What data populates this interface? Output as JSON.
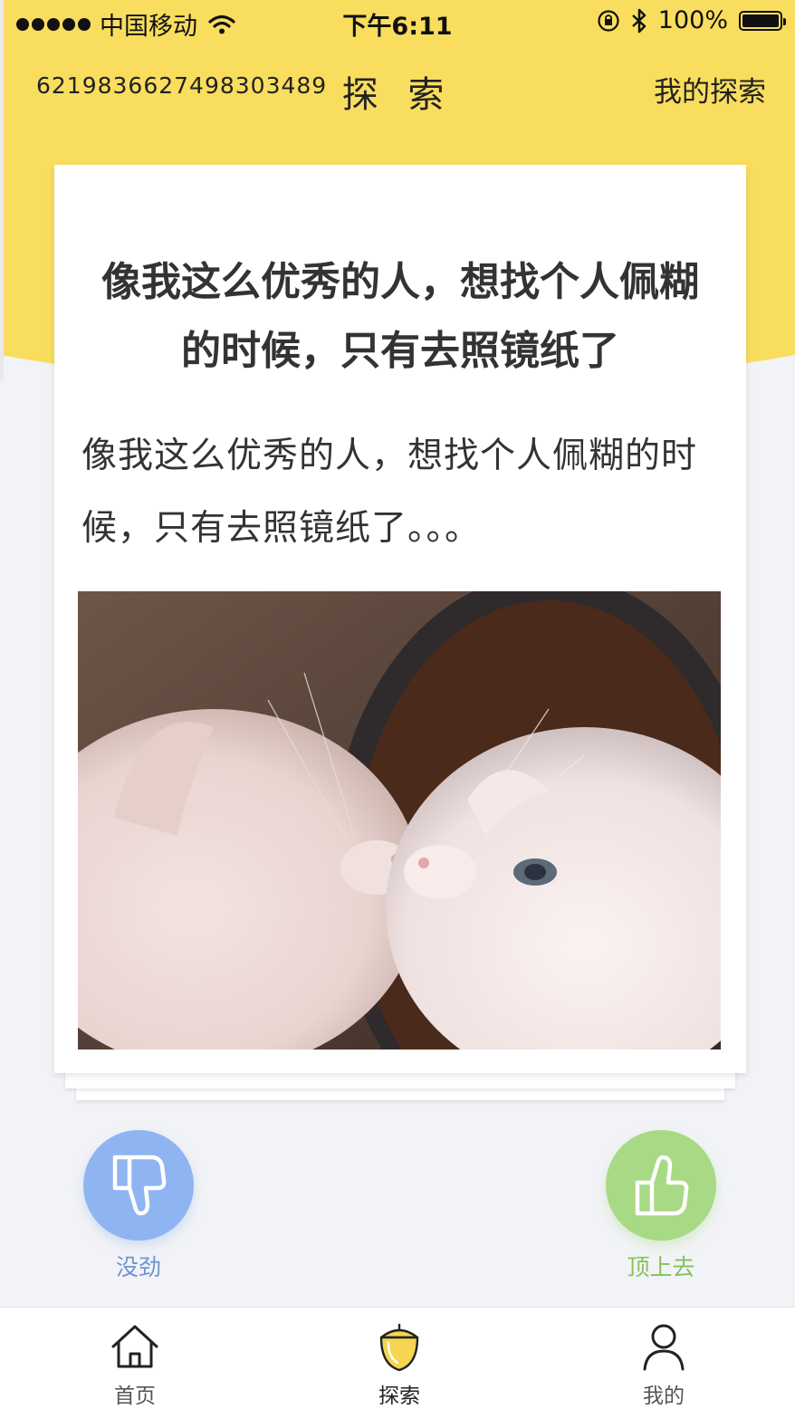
{
  "status_bar": {
    "carrier": "中国移动",
    "time": "下午6:11",
    "battery": "100%",
    "icons": [
      "signal-dots-icon",
      "wifi-icon",
      "orientation-lock-icon",
      "bluetooth-icon",
      "battery-icon"
    ]
  },
  "nav": {
    "id_text": "6219836627498303489",
    "title": "探 索",
    "right_link": "我的探索"
  },
  "card": {
    "title": "像我这么优秀的人，想找个人佩糊的时候，只有去照镜纸了",
    "body": "像我这么优秀的人，想找个人佩糊的时候，只有去照镜纸了。。。",
    "image": "kittens-mirror-photo"
  },
  "actions": {
    "dislike_label": "没劲",
    "like_label": "顶上去"
  },
  "tabs": [
    {
      "label": "首页",
      "icon": "home-icon"
    },
    {
      "label": "探索",
      "icon": "acorn-icon",
      "active": true
    },
    {
      "label": "我的",
      "icon": "user-icon"
    }
  ],
  "colors": {
    "header_yellow": "#f9dd5e",
    "dislike_blue": "#8fb4f2",
    "like_green": "#a8d985",
    "background": "#f2f3f6"
  }
}
